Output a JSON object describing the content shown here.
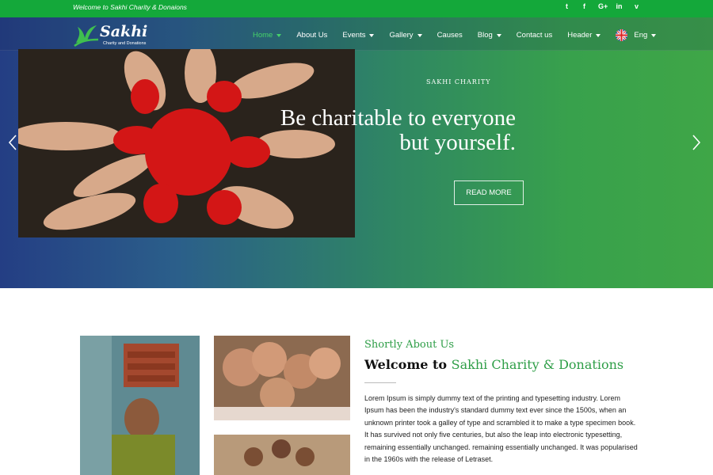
{
  "topbar": {
    "welcome": "Welcome to Sakhi Charity & Donaions",
    "social": [
      "twitter-icon",
      "facebook-icon",
      "google-plus-icon",
      "linkedin-icon",
      "vimeo-icon"
    ],
    "social_glyphs": [
      "t",
      "f",
      "G+",
      "in",
      "v"
    ]
  },
  "logo": {
    "name": "Sakhi",
    "tagline": "Charity and Donations"
  },
  "nav": {
    "home": "Home",
    "about": "About Us",
    "events": "Events",
    "gallery": "Gallery",
    "causes": "Causes",
    "blog": "Blog",
    "contact": "Contact us",
    "header": "Header",
    "language": "Eng"
  },
  "hero": {
    "eyebrow": "SAKHI CHARITY",
    "headline_line1": "Be charitable to everyone",
    "headline_line2": "but yourself.",
    "button": "READ MORE"
  },
  "about": {
    "subtitle": "Shortly About Us",
    "title_prefix": "Welcome to",
    "title_accent": "Sakhi Charity & Donations",
    "paragraph": "Lorem Ipsum is simply dummy text of the printing and typesetting industry. Lorem Ipsum has been the industry's standard dummy text ever since the 1500s, when an unknown printer took a galley of type and scrambled it to make a type specimen book. It has survived not only five centuries, but also the leap into electronic typesetting, remaining essentially unchanged. remaining essentially unchanged. It was popularised in the 1960s with the release of Letraset."
  },
  "colors": {
    "brand_green": "#14a83a",
    "accent_green": "#2e9e47",
    "active_nav": "#46d36a",
    "hero_start": "#243e84",
    "hero_end": "#3fa647"
  }
}
